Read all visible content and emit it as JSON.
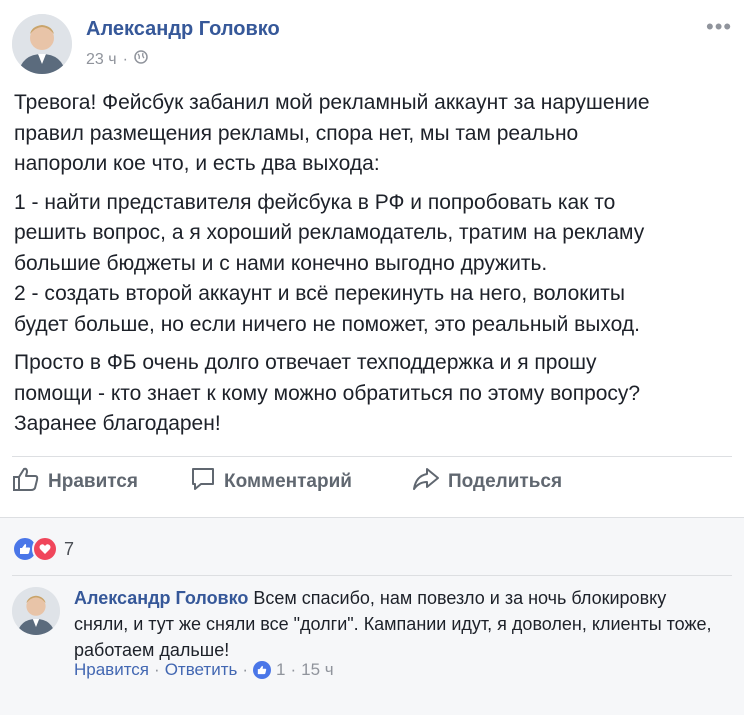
{
  "post": {
    "author": "Александр Головко",
    "time": "23 ч",
    "privacy_icon": "public-globe-icon",
    "menu_icon": "more-dots-icon",
    "paragraphs": [
      "Тревога! Фейсбук забанил мой рекламный аккаунт за нарушение\nправил размещения рекламы, спора нет, мы там реально\nнапороли кое что, и есть два выхода:",
      "1 - найти представителя фейсбука в РФ и попробовать как то\nрешить вопрос, а я хороший рекламодатель, тратим на рекламу\nбольшие бюджеты и с нами конечно выгодно дружить.\n2 - создать второй аккаунт и всё перекинуть на него, волокиты\nбудет больше, но если ничего не поможет, это реальный выход.",
      "Просто в ФБ очень долго отвечает техподдержка и я прошу\nпомощи - кто знает к кому можно обратиться по этому вопросу?\nЗаранее благодарен!"
    ]
  },
  "actions": {
    "like": "Нравится",
    "comment": "Комментарий",
    "share": "Поделиться"
  },
  "reactions": {
    "count": "7",
    "types": [
      "like",
      "love"
    ],
    "colors": {
      "like": "#4a76e8",
      "love": "#f0465b"
    }
  },
  "comment": {
    "author": "Александр Головко",
    "text": " Всем спасибо, нам повезло и за ночь блокировку сняли, и тут же сняли все \"долги\". Кампании идут, я доволен, клиенты тоже, работаем дальше!",
    "like_label": "Нравится",
    "reply_label": "Ответить",
    "sep": "·",
    "like_count": "1",
    "time": "15 ч"
  },
  "colors": {
    "link": "#365899",
    "muted": "#90949c",
    "action": "#606770"
  }
}
